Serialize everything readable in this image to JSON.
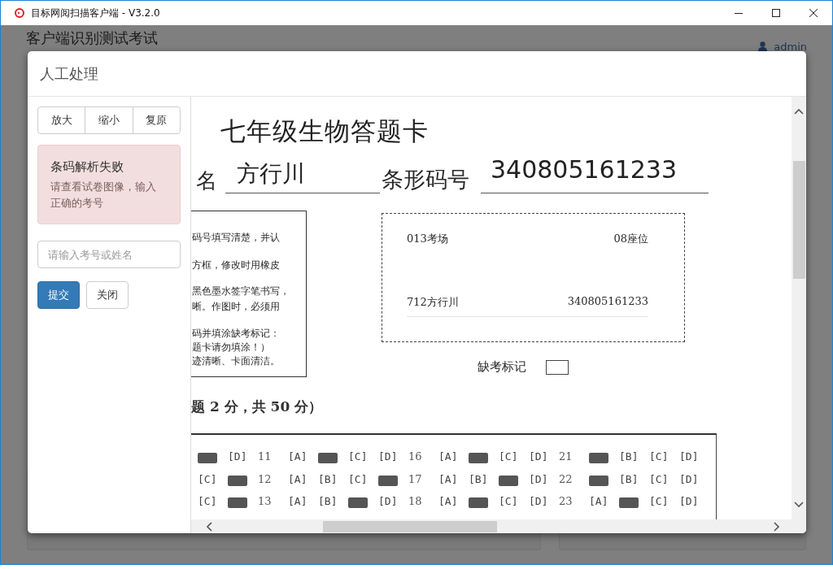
{
  "window": {
    "title": "目标网阅扫描客户端 - V3.2.0"
  },
  "background": {
    "page_title": "客户端识别测试考试",
    "user": "admin"
  },
  "dialog": {
    "title": "人工处理",
    "zoom_buttons": [
      "放大",
      "缩小",
      "复原"
    ],
    "alert": {
      "title": "条码解析失败",
      "message": "请查看试卷图像，输入正确的考号"
    },
    "search": {
      "placeholder": "请输入考号或姓名"
    },
    "submit": "提交",
    "close": "关闭"
  },
  "scan": {
    "title": "七年级生物答题卡",
    "name_label": "名",
    "name_value": "方行川",
    "barcode_label": "条形码号",
    "barcode_value": "340805161233",
    "notes": [
      "码号填写清楚，并认",
      "方框，修改时用橡皮",
      "黑色墨水签字笔书写，",
      "晰。作图时，必须用",
      "码并填涂缺考标记：",
      "题卡请勿填涂！）",
      "迹清晰、卡面清洁。"
    ],
    "info": {
      "room": "013考场",
      "seat": "08座位",
      "student": "712方行川",
      "number": "340805161233"
    },
    "absent_label": "缺考标记",
    "absent_checked": false,
    "section": "题 2 分，共 50 分）",
    "answer_rows": [
      [
        {
          "kind": "filled"
        },
        {
          "kind": "option",
          "text": "[D]"
        },
        {
          "kind": "number",
          "text": "11"
        },
        {
          "kind": "option",
          "text": "[A]"
        },
        {
          "kind": "filled"
        },
        {
          "kind": "option",
          "text": "[C]"
        },
        {
          "kind": "option",
          "text": "[D]"
        },
        {
          "kind": "number",
          "text": "16"
        },
        {
          "kind": "option",
          "text": "[A]"
        },
        {
          "kind": "filled"
        },
        {
          "kind": "option",
          "text": "[C]"
        },
        {
          "kind": "option",
          "text": "[D]"
        },
        {
          "kind": "number",
          "text": "21"
        },
        {
          "kind": "filled"
        },
        {
          "kind": "option",
          "text": "[B]"
        },
        {
          "kind": "option",
          "text": "[C]"
        },
        {
          "kind": "option",
          "text": "[D]"
        }
      ],
      [
        {
          "kind": "option",
          "text": "[C]"
        },
        {
          "kind": "filled"
        },
        {
          "kind": "number",
          "text": "12"
        },
        {
          "kind": "option",
          "text": "[A]"
        },
        {
          "kind": "option",
          "text": "[B]"
        },
        {
          "kind": "option",
          "text": "[C]"
        },
        {
          "kind": "filled"
        },
        {
          "kind": "number",
          "text": "17"
        },
        {
          "kind": "option",
          "text": "[A]"
        },
        {
          "kind": "option",
          "text": "[B]"
        },
        {
          "kind": "filled"
        },
        {
          "kind": "option",
          "text": "[D]"
        },
        {
          "kind": "number",
          "text": "22"
        },
        {
          "kind": "filled"
        },
        {
          "kind": "option",
          "text": "[B]"
        },
        {
          "kind": "option",
          "text": "[C]"
        },
        {
          "kind": "option",
          "text": "[D]"
        }
      ],
      [
        {
          "kind": "option",
          "text": "[C]"
        },
        {
          "kind": "filled"
        },
        {
          "kind": "number",
          "text": "13"
        },
        {
          "kind": "option",
          "text": "[A]"
        },
        {
          "kind": "option",
          "text": "[B]"
        },
        {
          "kind": "filled"
        },
        {
          "kind": "option",
          "text": "[D]"
        },
        {
          "kind": "number",
          "text": "18"
        },
        {
          "kind": "option",
          "text": "[A]"
        },
        {
          "kind": "filled"
        },
        {
          "kind": "option",
          "text": "[C]"
        },
        {
          "kind": "option",
          "text": "[D]"
        },
        {
          "kind": "number",
          "text": "23"
        },
        {
          "kind": "option",
          "text": "[A]"
        },
        {
          "kind": "filled"
        },
        {
          "kind": "option",
          "text": "[C]"
        },
        {
          "kind": "option",
          "text": "[D]"
        }
      ]
    ]
  }
}
